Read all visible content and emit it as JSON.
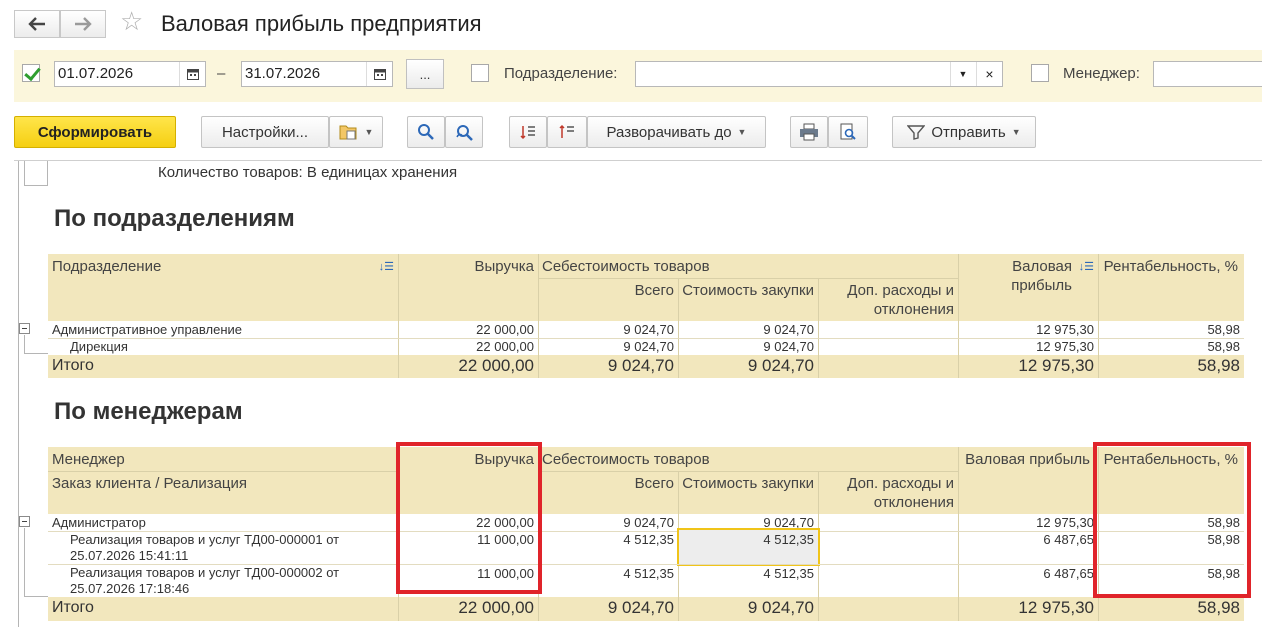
{
  "window": {
    "title": "Валовая прибыль предприятия",
    "back_icon": "arrow-left-icon",
    "forward_icon": "arrow-right-icon",
    "favorite_icon": "star-icon"
  },
  "filters": {
    "period_enabled": true,
    "date_from": "01.07.2026",
    "date_sep": "–",
    "date_to": "31.07.2026",
    "period_btn": "...",
    "division_label": "Подразделение:",
    "division_value": "",
    "manager_label": "Менеджер:",
    "manager_value": ""
  },
  "toolbar": {
    "generate": "Сформировать",
    "settings": "Настройки...",
    "expand": "Разворачивать до",
    "send": "Отправить"
  },
  "report": {
    "param": "Количество товаров: В единицах хранения",
    "sections": [
      {
        "title": "По подразделениям",
        "headers": {
          "col1": "Подразделение",
          "col1b": "",
          "revenue": "Выручка",
          "cost_group": "Себестоимость товаров",
          "total": "Всего",
          "purchase": "Стоимость закупки",
          "extra": "Доп. расходы и отклонения",
          "profit": "Валовая прибыль",
          "margin": "Рентабельность, %"
        },
        "rows": [
          {
            "name": "Административное управление",
            "revenue": "22 000,00",
            "total": "9 024,70",
            "purchase": "9 024,70",
            "extra": "",
            "profit": "12 975,30",
            "margin": "58,98"
          },
          {
            "name": "Дирекция",
            "revenue": "22 000,00",
            "total": "9 024,70",
            "purchase": "9 024,70",
            "extra": "",
            "profit": "12 975,30",
            "margin": "58,98"
          }
        ],
        "total_row": {
          "name": "Итого",
          "revenue": "22 000,00",
          "total": "9 024,70",
          "purchase": "9 024,70",
          "extra": "",
          "profit": "12 975,30",
          "margin": "58,98"
        }
      },
      {
        "title": "По менеджерам",
        "headers": {
          "col1": "Менеджер",
          "col1b": "Заказ клиента / Реализация",
          "revenue": "Выручка",
          "cost_group": "Себестоимость товаров",
          "total": "Всего",
          "purchase": "Стоимость закупки",
          "extra": "Доп. расходы и отклонения",
          "profit": "Валовая прибыль",
          "margin": "Рентабельность, %"
        },
        "rows": [
          {
            "name": "Администратор",
            "revenue": "22 000,00",
            "total": "9 024,70",
            "purchase": "9 024,70",
            "extra": "",
            "profit": "12 975,30",
            "margin": "58,98"
          },
          {
            "name": "Реализация товаров и услуг ТД00-000001 от 25.07.2026 15:41:11",
            "revenue": "11 000,00",
            "total": "4 512,35",
            "purchase": "4 512,35",
            "extra": "",
            "profit": "6 487,65",
            "margin": "58,98"
          },
          {
            "name": "Реализация товаров и услуг ТД00-000002 от 25.07.2026 17:18:46",
            "revenue": "11 000,00",
            "total": "4 512,35",
            "purchase": "4 512,35",
            "extra": "",
            "profit": "6 487,65",
            "margin": "58,98"
          }
        ],
        "total_row": {
          "name": "Итого",
          "revenue": "22 000,00",
          "total": "9 024,70",
          "purchase": "9 024,70",
          "extra": "",
          "profit": "12 975,30",
          "margin": "58,98"
        }
      }
    ]
  }
}
